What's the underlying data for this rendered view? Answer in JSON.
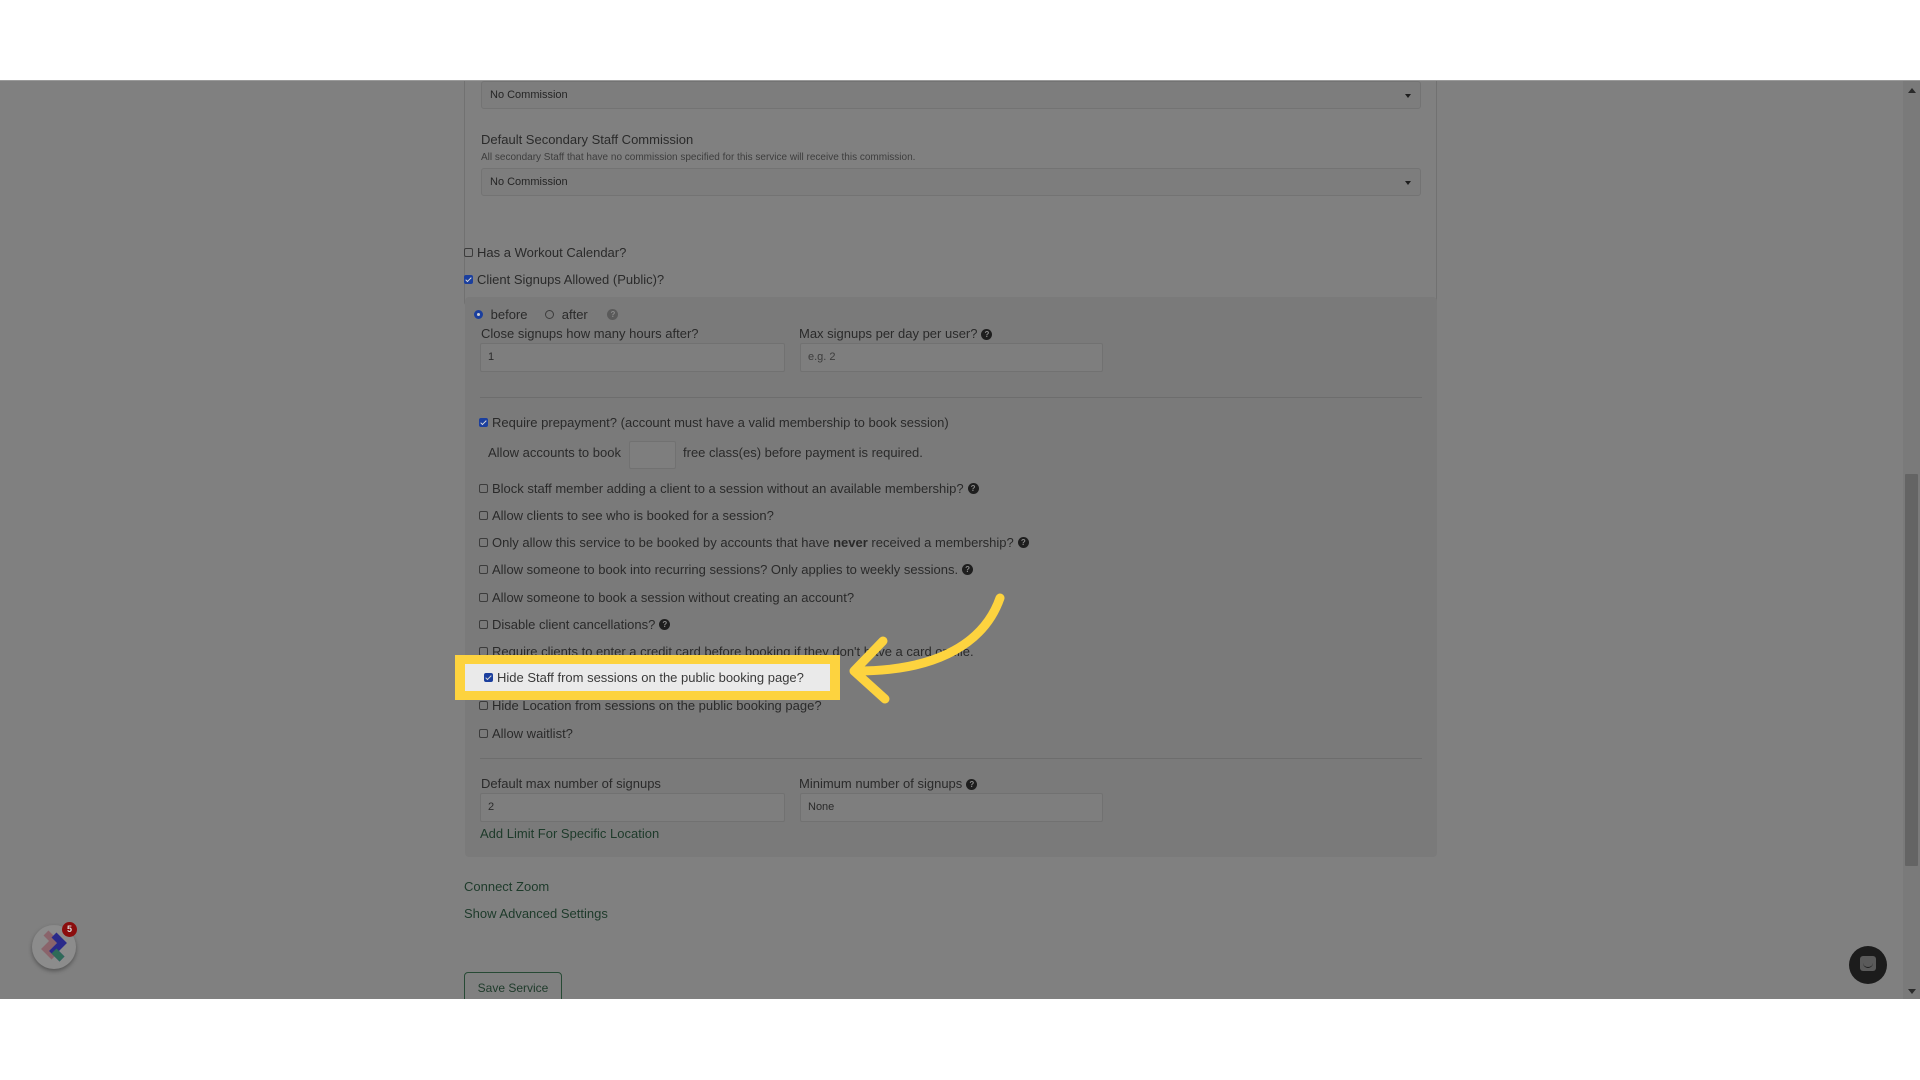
{
  "commission": {
    "primary_select_value": "No Commission",
    "secondary_title": "Default Secondary Staff Commission",
    "secondary_help": "All secondary Staff that have no commission specified for this service will receive this commission.",
    "secondary_select_value": "No Commission"
  },
  "options_top": {
    "workout_calendar": {
      "label": "Has a Workout Calendar?",
      "checked": false
    },
    "client_signups": {
      "label": "Client Signups Allowed (Public)?",
      "checked": true
    }
  },
  "signups_panel": {
    "timing": {
      "before_label": "before",
      "after_label": "after",
      "selected": "before"
    },
    "close_hours": {
      "label": "Close signups how many hours after?",
      "value": "1"
    },
    "max_per_day": {
      "label": "Max signups per day per user?",
      "placeholder": "e.g. 2"
    },
    "require_prepayment": {
      "label": "Require prepayment? (account must have a valid membership to book session)",
      "checked": true
    },
    "free_classes": {
      "prefix": "Allow accounts to book",
      "suffix": "free class(es) before payment is required.",
      "value": ""
    },
    "options": [
      {
        "label": "Block staff member adding a client to a session without an available membership?",
        "checked": false,
        "help": true
      },
      {
        "label": "Allow clients to see who is booked for a session?",
        "checked": false,
        "help": false
      },
      {
        "label_pre": "Only allow this service to be booked by accounts that have ",
        "label_bold": "never",
        "label_post": " received a membership?",
        "checked": false,
        "help": true
      },
      {
        "label": "Allow someone to book into recurring sessions? Only applies to weekly sessions.",
        "checked": false,
        "help": true
      },
      {
        "label": "Allow someone to book a session without creating an account?",
        "checked": false,
        "help": false
      },
      {
        "label": "Disable client cancellations?",
        "checked": false,
        "help": true
      },
      {
        "label": "Require clients to enter a credit card before booking if they don't have a card on file.",
        "checked": false,
        "help": false
      },
      {
        "label": "Hide Staff from sessions on the public booking page?",
        "checked": true,
        "help": false,
        "highlighted": true
      },
      {
        "label": "Hide Location from sessions on the public booking page?",
        "checked": false,
        "help": false
      },
      {
        "label": "Allow waitlist?",
        "checked": false,
        "help": false
      }
    ],
    "default_max": {
      "label": "Default max number of signups",
      "value": "2"
    },
    "min_signups": {
      "label": "Minimum number of signups",
      "value": "None"
    },
    "add_limit_link": "Add Limit For Specific Location"
  },
  "links": {
    "connect_zoom": "Connect Zoom",
    "advanced_settings": "Show Advanced Settings"
  },
  "save_button": "Save Service",
  "app_widget": {
    "badge_count": "5"
  },
  "help_glyph": "?",
  "annotation": {
    "color": "#fdd33f"
  }
}
